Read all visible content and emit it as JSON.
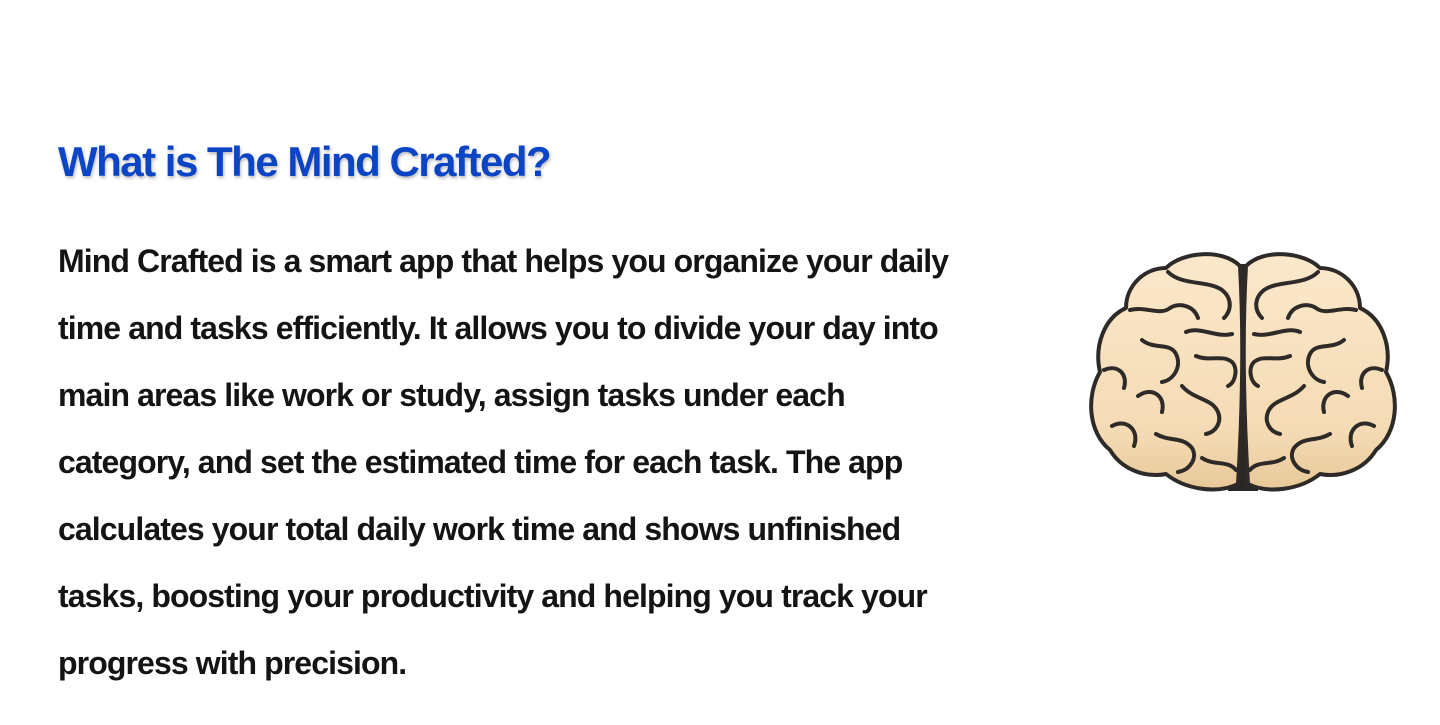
{
  "about": {
    "title": "What is The Mind Crafted?",
    "description_lines": [
      "Mind Crafted is a smart app that helps you organize your daily",
      "time and tasks efficiently. It allows you to divide your day into",
      "main areas like work or study, assign tasks under each",
      "category, and set the estimated time for each task. The app",
      "calculates your total daily work time and shows unfinished",
      "tasks, boosting your productivity and helping you track your",
      "progress with precision."
    ],
    "illustration_icon": "brain-icon"
  },
  "colors": {
    "title": "#0b45c6",
    "body_text": "#141414",
    "background": "#ffffff",
    "brain_fill": "#f7dfbc",
    "brain_outline": "#2e2a27"
  }
}
